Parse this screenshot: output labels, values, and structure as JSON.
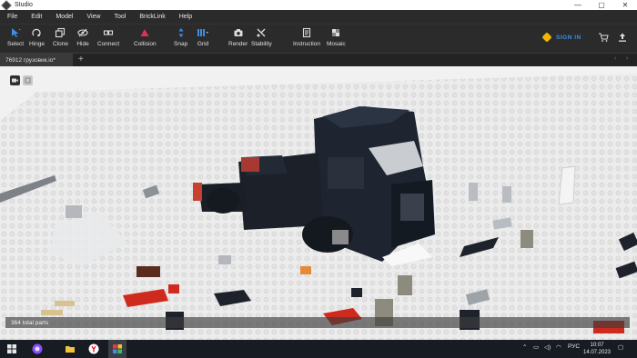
{
  "window": {
    "title": "Studio",
    "controls": [
      "—",
      "▢",
      "✕"
    ]
  },
  "menu": [
    "File",
    "Edit",
    "Model",
    "View",
    "Tool",
    "BrickLink",
    "Help"
  ],
  "toolbar": {
    "tools": [
      {
        "label": "Select",
        "icon": "cursor-icon"
      },
      {
        "label": "Hinge",
        "icon": "hinge-icon"
      },
      {
        "label": "Clone",
        "icon": "clone-icon"
      },
      {
        "label": "Hide",
        "icon": "hide-icon"
      },
      {
        "label": "Connect",
        "icon": "connect-icon"
      },
      {
        "label": "Collision",
        "icon": "collision-icon"
      },
      {
        "label": "Snap",
        "icon": "snap-icon"
      },
      {
        "label": "Grid",
        "icon": "grid-icon"
      },
      {
        "label": "Render",
        "icon": "camera-icon"
      },
      {
        "label": "Stability",
        "icon": "stability-icon"
      },
      {
        "label": "Instruction",
        "icon": "instruction-icon"
      },
      {
        "label": "Mosaic",
        "icon": "mosaic-icon"
      }
    ],
    "sign_in": "SIGN IN",
    "accent": "#3d8fe6"
  },
  "tabs": {
    "active": "76912 грузовик.io*",
    "add": "+"
  },
  "viewport": {
    "parts_count": "364 total parts",
    "background": "#efefef"
  },
  "taskbar": {
    "apps": [
      "windows-start-icon",
      "alice-assistant-icon",
      "file-explorer-icon",
      "yandex-browser-icon",
      "bricklink-studio-icon"
    ],
    "language": "РУС",
    "time": "10:07",
    "date": "14.07.2023"
  }
}
